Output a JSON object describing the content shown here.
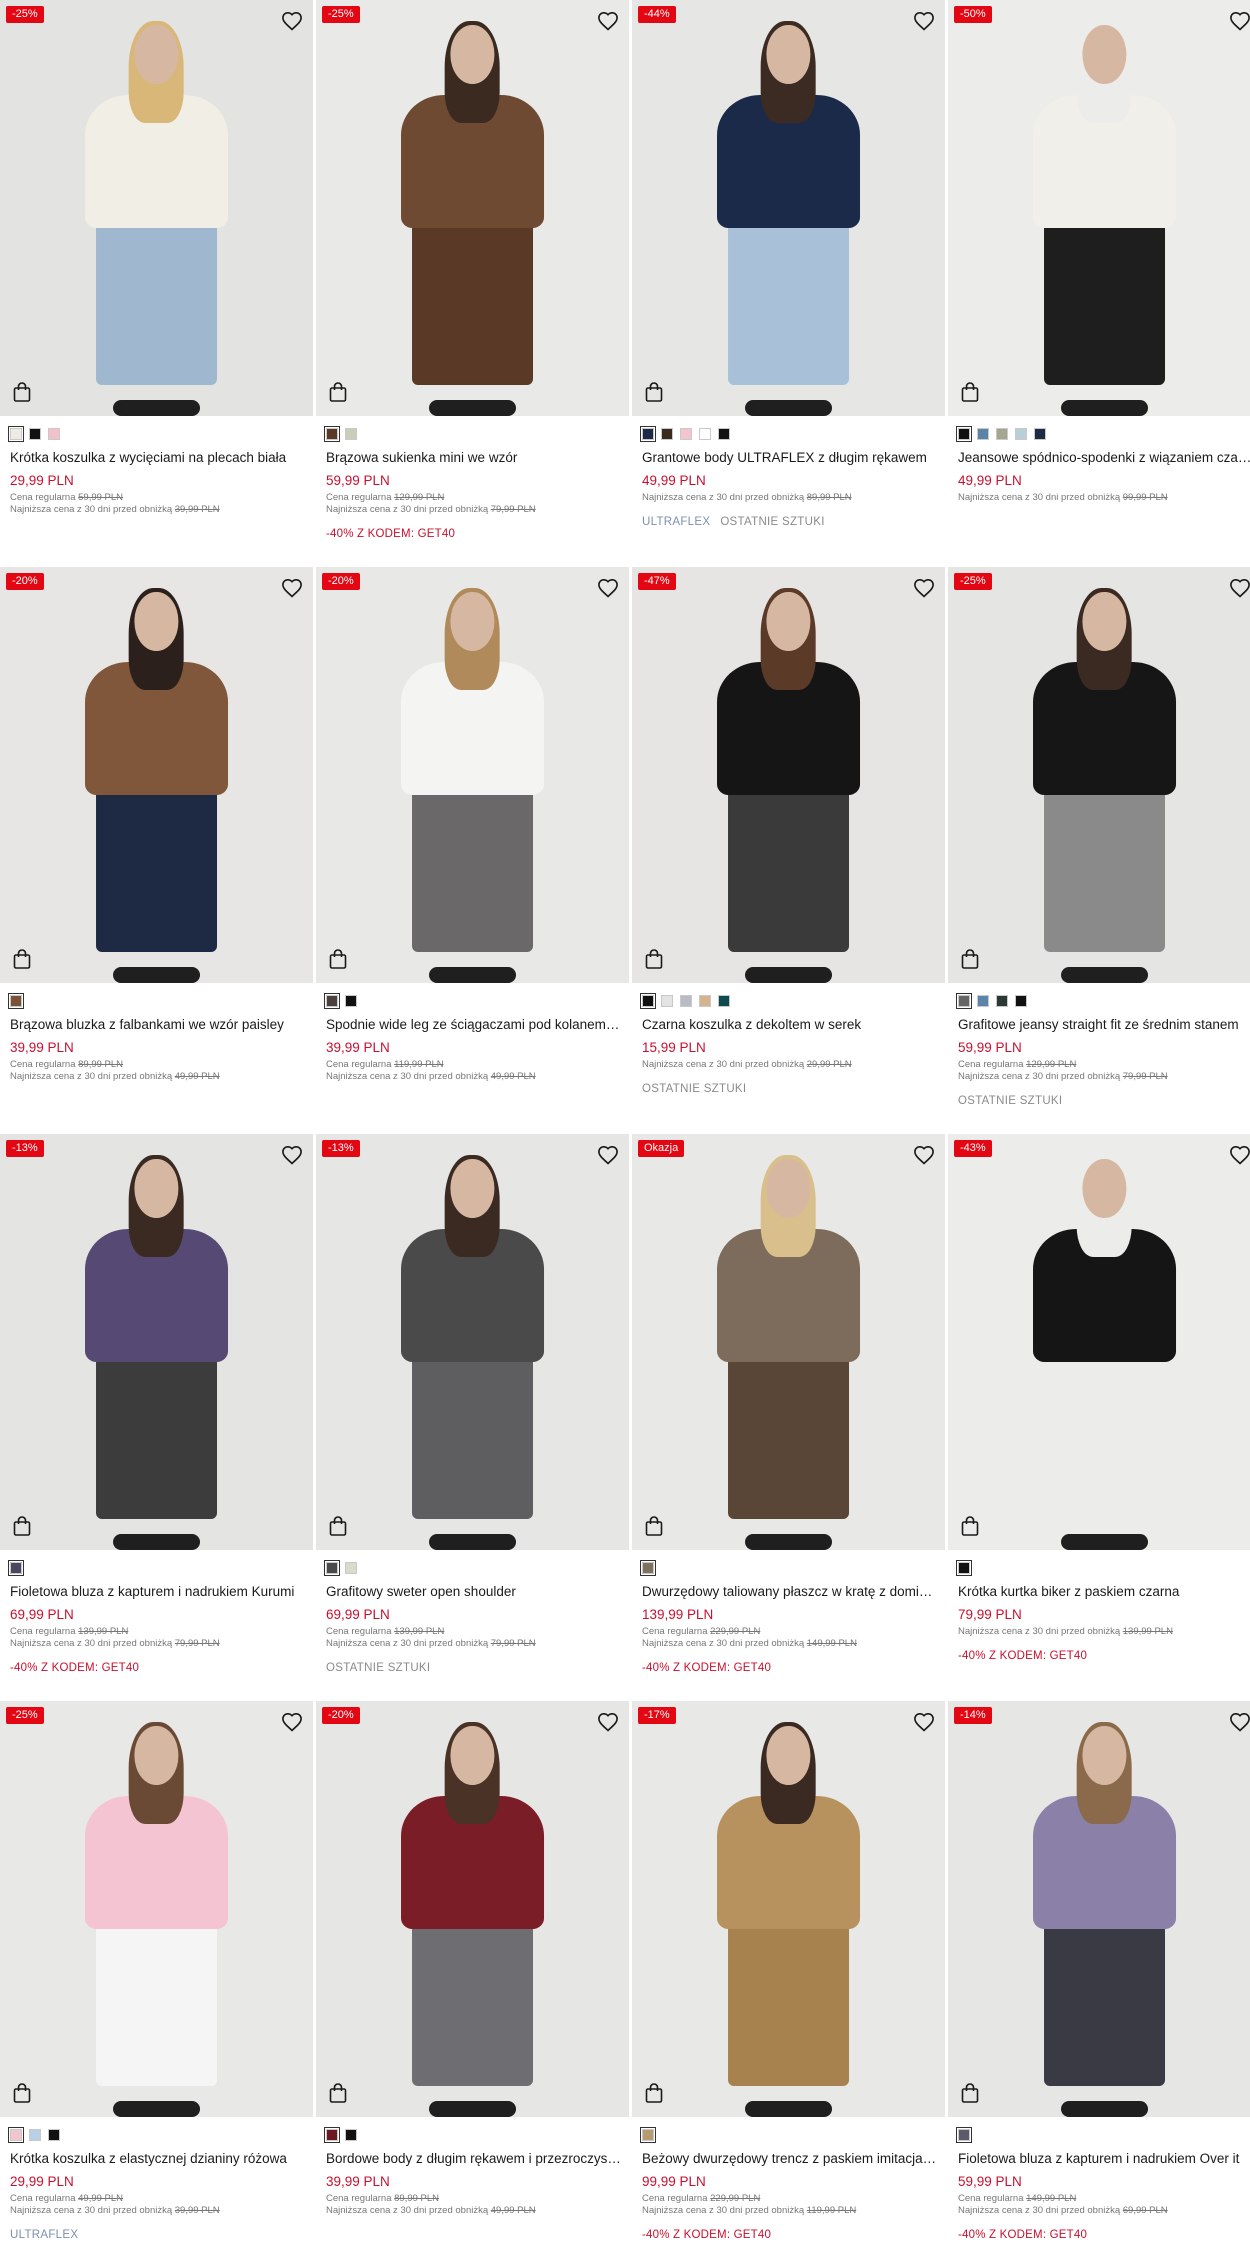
{
  "accent_color": "#c8102e",
  "badge_color": "#e30613",
  "icons": {
    "favorite": "heart-outline-icon",
    "add_to_cart": "shopping-bag-icon"
  },
  "products": [
    {
      "badge": "-25%",
      "name": "Krótka koszulka z wycięciami na plecach biała",
      "price": "29,99 PLN",
      "regular_label": "Cena regularna",
      "regular_price": "59,99 PLN",
      "lowest_label": "Najniższa cena z 30 dni przed obniżką",
      "lowest_price": "39,99 PLN",
      "promo": "",
      "tags": [],
      "swatches": [
        "#eeebe2",
        "#111111",
        "#f2c1c9"
      ],
      "photo": {
        "bg": "#e3e3e1",
        "hair": "#d9b779",
        "top": "#f1eee6",
        "bottom": "#9fb8d0"
      }
    },
    {
      "badge": "-25%",
      "name": "Brązowa sukienka mini we wzór",
      "price": "59,99 PLN",
      "regular_label": "Cena regularna",
      "regular_price": "129,99 PLN",
      "lowest_label": "Najniższa cena z 30 dni przed obniżką",
      "lowest_price": "79,99 PLN",
      "promo": "-40% Z KODEM: GET40",
      "tags": [],
      "swatches": [
        "#5a3a26",
        "#c8cdb7"
      ],
      "photo": {
        "bg": "#e9e9e7",
        "hair": "#3a2a20",
        "top": "#6e4a32",
        "bottom": "#5a3a26"
      }
    },
    {
      "badge": "-44%",
      "name": "Grantowe body ULTRAFLEX z długim rękawem",
      "price": "49,99 PLN",
      "regular_label": "",
      "regular_price": "",
      "lowest_label": "Najniższa cena z 30 dni przed obniżką",
      "lowest_price": "89,99 PLN",
      "promo": "",
      "tags": [
        "ULTRAFLEX",
        "OSTATNIE SZTUKI"
      ],
      "swatches": [
        "#1c2a4a",
        "#3a2a1e",
        "#f3c6cf",
        "#ffffff",
        "#111111"
      ],
      "photo": {
        "bg": "#e6e6e4",
        "hair": "#3b2b22",
        "top": "#1c2a4a",
        "bottom": "#a8c1d8"
      }
    },
    {
      "badge": "-50%",
      "name": "Jeansowe spódnico-spodenki z wiązaniem czarne",
      "price": "49,99 PLN",
      "regular_label": "",
      "regular_price": "",
      "lowest_label": "Najniższa cena z 30 dni przed obniżką",
      "lowest_price": "99,99 PLN",
      "promo": "",
      "tags": [],
      "swatches": [
        "#111111",
        "#5c84a8",
        "#a6a58f",
        "#b9cfd8",
        "#1d2b44"
      ],
      "photo": {
        "bg": "#ececea",
        "hair": "#ececea",
        "top": "#f0efe9",
        "bottom": "#1e1e1e"
      }
    },
    {
      "badge": "-20%",
      "name": "Brązowa bluzka z falbankami we wzór paisley",
      "price": "39,99 PLN",
      "regular_label": "Cena regularna",
      "regular_price": "89,99 PLN",
      "lowest_label": "Najniższa cena z 30 dni przed obniżką",
      "lowest_price": "49,99 PLN",
      "promo": "",
      "tags": [],
      "swatches": [
        "#7a5236"
      ],
      "photo": {
        "bg": "#e7e6e4",
        "hair": "#2b201b",
        "top": "#80573a",
        "bottom": "#1e2a44"
      }
    },
    {
      "badge": "-20%",
      "name": "Spodnie wide leg ze ściągaczami pod kolanem grafitowe",
      "price": "39,99 PLN",
      "regular_label": "Cena regularna",
      "regular_price": "119,99 PLN",
      "lowest_label": "Najniższa cena z 30 dni przed obniżką",
      "lowest_price": "49,99 PLN",
      "promo": "",
      "tags": [],
      "swatches": [
        "#4a4040",
        "#111111"
      ],
      "photo": {
        "bg": "#e8e8e6",
        "hair": "#b08a5a",
        "top": "#f4f4f2",
        "bottom": "#6a6868"
      }
    },
    {
      "badge": "-47%",
      "name": "Czarna koszulka z dekoltem w serek",
      "price": "15,99 PLN",
      "regular_label": "",
      "regular_price": "",
      "lowest_label": "Najniższa cena z 30 dni przed obniżką",
      "lowest_price": "29,99 PLN",
      "promo": "",
      "tags": [
        "OSTATNIE SZTUKI"
      ],
      "swatches": [
        "#111111",
        "#e3e3e3",
        "#b9bcc4",
        "#d4b48e",
        "#0f4a4f"
      ],
      "photo": {
        "bg": "#e6e5e3",
        "hair": "#5b3a28",
        "top": "#151515",
        "bottom": "#3a3a3a"
      }
    },
    {
      "badge": "-25%",
      "name": "Grafitowe jeansy straight fit ze średnim stanem",
      "price": "59,99 PLN",
      "regular_label": "Cena regularna",
      "regular_price": "129,99 PLN",
      "lowest_label": "Najniższa cena z 30 dni przed obniżką",
      "lowest_price": "79,99 PLN",
      "promo": "",
      "tags": [
        "OSTATNIE SZTUKI"
      ],
      "swatches": [
        "#666666",
        "#5c84a8",
        "#2a3a33",
        "#111111"
      ],
      "photo": {
        "bg": "#e5e5e3",
        "hair": "#3a2a22",
        "top": "#161616",
        "bottom": "#8a8a8a"
      }
    },
    {
      "badge": "-13%",
      "name": "Fioletowa bluza z kapturem i nadrukiem Kurumi",
      "price": "69,99 PLN",
      "regular_label": "Cena regularna",
      "regular_price": "139,99 PLN",
      "lowest_label": "Najniższa cena z 30 dni przed obniżką",
      "lowest_price": "79,99 PLN",
      "promo": "-40% Z KODEM: GET40",
      "tags": [],
      "swatches": [
        "#4e4660"
      ],
      "photo": {
        "bg": "#e4e4e2",
        "hair": "#3b2a22",
        "top": "#564a74",
        "bottom": "#3c3c3c"
      }
    },
    {
      "badge": "-13%",
      "name": "Grafitowy sweter open shoulder",
      "price": "69,99 PLN",
      "regular_label": "Cena regularna",
      "regular_price": "139,99 PLN",
      "lowest_label": "Najniższa cena z 30 dni przed obniżką",
      "lowest_price": "79,99 PLN",
      "promo": "",
      "tags": [
        "OSTATNIE SZTUKI"
      ],
      "swatches": [
        "#4a4a4a",
        "#d9dcc7"
      ],
      "photo": {
        "bg": "#e6e6e4",
        "hair": "#3a2a22",
        "top": "#4a4a4a",
        "bottom": "#5e5e60"
      }
    },
    {
      "badge": "Okazja",
      "name": "Dwurzędowy taliowany płaszcz w kratę z domieszką wełny",
      "price": "139,99 PLN",
      "regular_label": "Cena regularna",
      "regular_price": "229,99 PLN",
      "lowest_label": "Najniższa cena z 30 dni przed obniżką",
      "lowest_price": "149,99 PLN",
      "promo": "-40% Z KODEM: GET40",
      "tags": [],
      "swatches": [
        "#7d7262"
      ],
      "photo": {
        "bg": "#e8e8e6",
        "hair": "#d9bf8c",
        "top": "#7d6c5c",
        "bottom": "#5a4636"
      }
    },
    {
      "badge": "-43%",
      "name": "Krótka kurtka biker z paskiem czarna",
      "price": "79,99 PLN",
      "regular_label": "",
      "regular_price": "",
      "lowest_label": "Najniższa cena z 30 dni przed obniżką",
      "lowest_price": "139,99 PLN",
      "promo": "-40% Z KODEM: GET40",
      "tags": [],
      "swatches": [
        "#111111"
      ],
      "photo": {
        "bg": "#ececea",
        "hair": "#ececea",
        "top": "#151515",
        "bottom": "#ececea"
      }
    },
    {
      "badge": "-25%",
      "name": "Krótka koszulka z elastycznej dzianiny różowa",
      "price": "29,99 PLN",
      "regular_label": "Cena regularna",
      "regular_price": "49,99 PLN",
      "lowest_label": "Najniższa cena z 30 dni przed obniżką",
      "lowest_price": "39,99 PLN",
      "promo": "",
      "tags": [
        "ULTRAFLEX"
      ],
      "swatches": [
        "#f3c6cf",
        "#b9cfe6",
        "#111111"
      ],
      "photo": {
        "bg": "#e8e8e6",
        "hair": "#6a4a34",
        "top": "#f5c4d2",
        "bottom": "#f5f5f5"
      }
    },
    {
      "badge": "-20%",
      "name": "Bordowe body z długim rękawem i przezroczystymi wstawkami",
      "price": "39,99 PLN",
      "regular_label": "Cena regularna",
      "regular_price": "89,99 PLN",
      "lowest_label": "Najniższa cena z 30 dni przed obniżką",
      "lowest_price": "49,99 PLN",
      "promo": "",
      "tags": [],
      "swatches": [
        "#6b1a22",
        "#111111"
      ],
      "photo": {
        "bg": "#e6e6e4",
        "hair": "#4a3226",
        "top": "#7a1d26",
        "bottom": "#6e6e72"
      }
    },
    {
      "badge": "-17%",
      "name": "Beżowy dwurzędowy trencz z paskiem imitacja zamszu",
      "price": "99,99 PLN",
      "regular_label": "Cena regularna",
      "regular_price": "229,99 PLN",
      "lowest_label": "Najniższa cena z 30 dni przed obniżką",
      "lowest_price": "119,99 PLN",
      "promo": "-40% Z KODEM: GET40",
      "tags": [],
      "swatches": [
        "#b79a70"
      ],
      "photo": {
        "bg": "#e8e8e6",
        "hair": "#3a2a22",
        "top": "#b8925e",
        "bottom": "#a8824e"
      }
    },
    {
      "badge": "-14%",
      "name": "Fioletowa bluza z kapturem i nadrukiem Over it",
      "price": "59,99 PLN",
      "regular_label": "Cena regularna",
      "regular_price": "149,99 PLN",
      "lowest_label": "Najniższa cena z 30 dni przed obniżką",
      "lowest_price": "69,99 PLN",
      "promo": "-40% Z KODEM: GET40",
      "tags": [],
      "swatches": [
        "#5a5a6a"
      ],
      "photo": {
        "bg": "#e6e6e4",
        "hair": "#8a6a4a",
        "top": "#8a80a8",
        "bottom": "#3a3a44"
      }
    }
  ]
}
